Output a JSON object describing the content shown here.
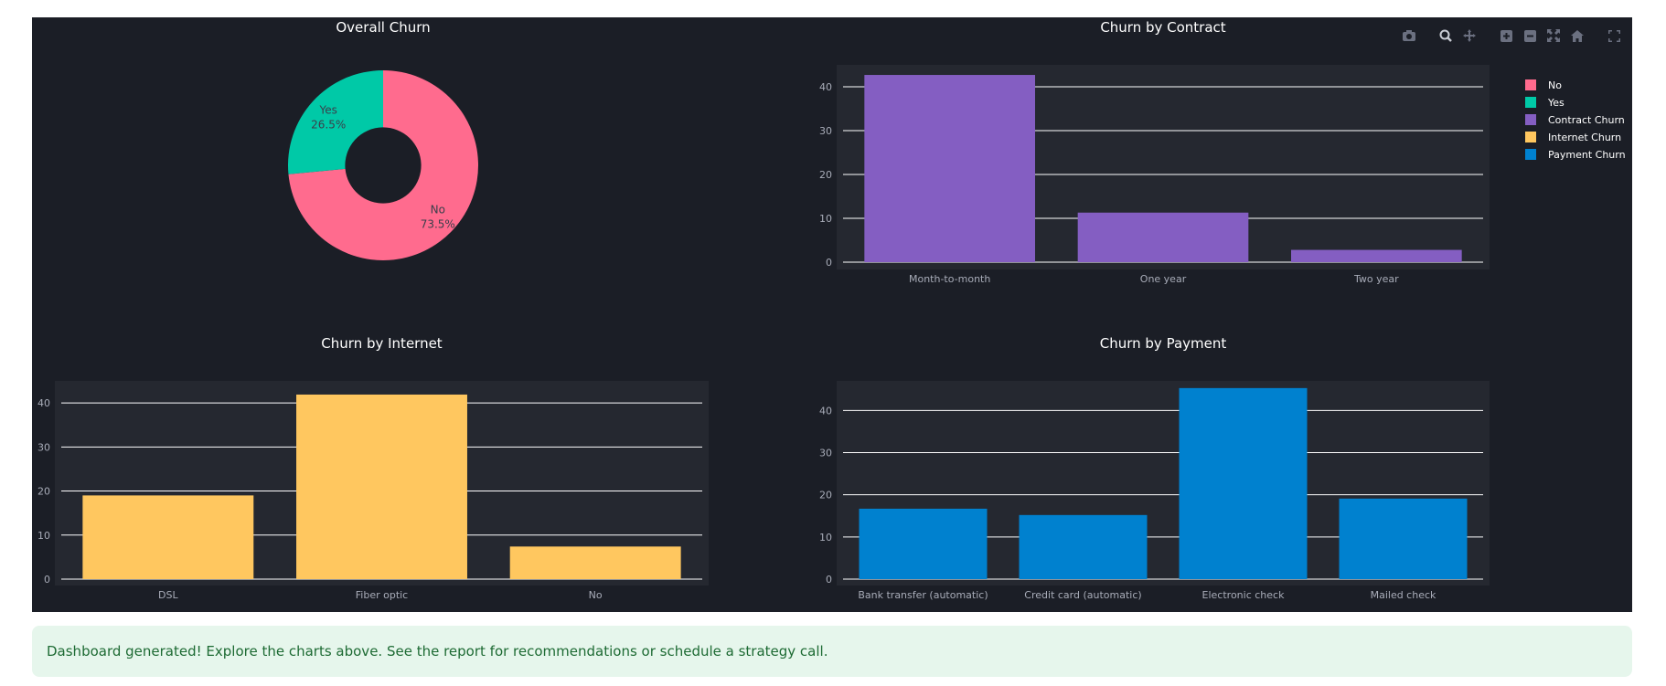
{
  "colors": {
    "no": "#ff6b8e",
    "yes": "#00c9a7",
    "contract": "#845ec2",
    "internet": "#ffc75f",
    "payment": "#0081cf",
    "panel_bg": "#252830",
    "grid": "#ffffff"
  },
  "modebar": {
    "icons": [
      "camera-icon",
      "zoom-icon",
      "pan-icon",
      "zoom-in-icon",
      "zoom-out-icon",
      "autoscale-icon",
      "home-icon",
      "fullscreen-icon"
    ]
  },
  "legend": {
    "items": [
      {
        "label": "No",
        "color": "#ff6b8e"
      },
      {
        "label": "Yes",
        "color": "#00c9a7"
      },
      {
        "label": "Contract Churn",
        "color": "#845ec2"
      },
      {
        "label": "Internet Churn",
        "color": "#ffc75f"
      },
      {
        "label": "Payment Churn",
        "color": "#0081cf"
      }
    ]
  },
  "chart_data": [
    {
      "type": "pie",
      "title": "Overall Churn",
      "hole": 0.4,
      "slices": [
        {
          "label": "No",
          "percent_label": "73.5%",
          "value": 73.5,
          "color": "#ff6b8e"
        },
        {
          "label": "Yes",
          "percent_label": "26.5%",
          "value": 26.5,
          "color": "#00c9a7"
        }
      ]
    },
    {
      "type": "bar",
      "title": "Churn by Contract",
      "categories": [
        "Month-to-month",
        "One year",
        "Two year"
      ],
      "series": [
        {
          "name": "Contract Churn",
          "values": [
            42.7,
            11.3,
            2.8
          ],
          "color": "#845ec2"
        }
      ],
      "ylim": [
        0,
        45
      ],
      "yticks": [
        0,
        10,
        20,
        30,
        40
      ],
      "grid": true
    },
    {
      "type": "bar",
      "title": "Churn by Internet",
      "categories": [
        "DSL",
        "Fiber optic",
        "No"
      ],
      "series": [
        {
          "name": "Internet Churn",
          "values": [
            19.0,
            41.9,
            7.4
          ],
          "color": "#ffc75f"
        }
      ],
      "ylim": [
        0,
        45
      ],
      "yticks": [
        0,
        10,
        20,
        30,
        40
      ],
      "grid": true
    },
    {
      "type": "bar",
      "title": "Churn by Payment",
      "categories": [
        "Bank transfer (automatic)",
        "Credit card (automatic)",
        "Electronic check",
        "Mailed check"
      ],
      "series": [
        {
          "name": "Payment Churn",
          "values": [
            16.7,
            15.2,
            45.3,
            19.1
          ],
          "color": "#0081cf"
        }
      ],
      "ylim": [
        0,
        47
      ],
      "yticks": [
        0,
        10,
        20,
        30,
        40
      ],
      "grid": true
    }
  ],
  "alert": {
    "message": "Dashboard generated! Explore the charts above. See the report for recommendations or schedule a strategy call."
  }
}
